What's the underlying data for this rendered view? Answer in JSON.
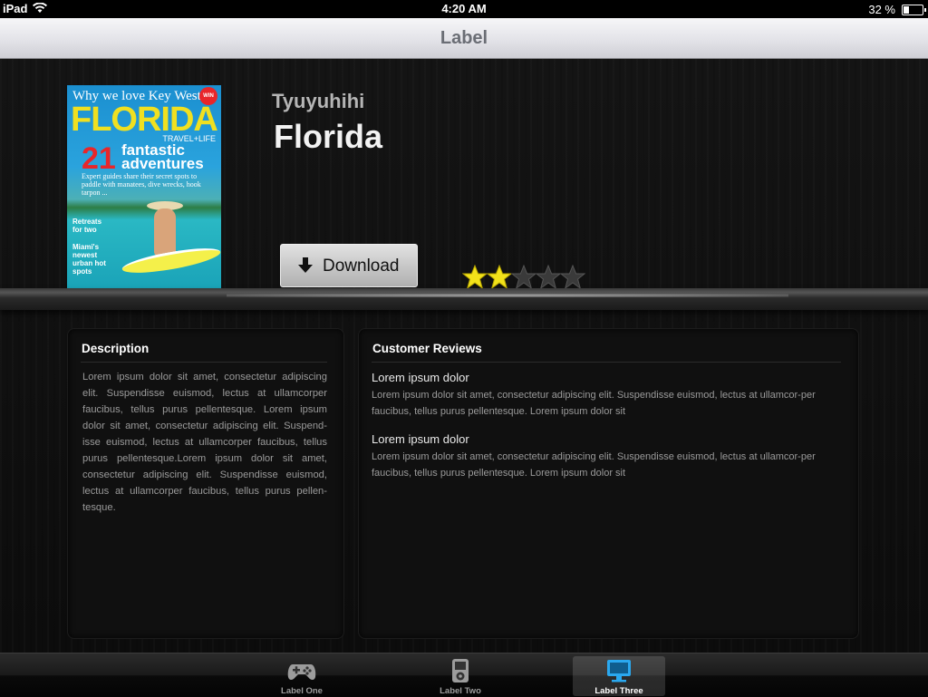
{
  "status_bar": {
    "device": "iPad",
    "time": "4:20 AM",
    "battery": "32 %",
    "battery_level_percent": 32
  },
  "nav": {
    "title": "Label"
  },
  "magazine": {
    "cover": {
      "tagline": "Why we love Key West",
      "masthead": "FLORIDA",
      "brand": "TRAVEL+LIFE",
      "badge": "WIN",
      "headline_number": "21",
      "headline_text": "fantastic adventures",
      "blurb": "Expert guides share their secret spots to paddle with manatees, dive wrecks, hook tarpon ...",
      "side1": "Retreats for two",
      "side2": "Miami's newest urban hot spots"
    },
    "subtitle": "Tyuyuhihi",
    "title": "Florida",
    "download_label": "Download",
    "rating": {
      "value": 2,
      "max": 5,
      "filled_color": "#f2e21a",
      "empty_color": "#3a3a3a"
    }
  },
  "description": {
    "heading": "Description",
    "text": "Lorem ipsum dolor sit amet, consectetur adipiscing elit. Suspendisse euismod, lectus at ullamcorper faucibus, tellus purus pellentesque. Lorem ipsum dolor sit amet, consectetur adipiscing elit. Suspend-isse euismod, lectus at ullamcorper faucibus, tellus purus pellentesque.Lorem ipsum dolor sit amet, consectetur adipiscing elit. Suspendisse euismod, lectus at ullamcorper faucibus, tellus purus pellen-tesque."
  },
  "reviews": {
    "heading": "Customer Reviews",
    "items": [
      {
        "title": "Lorem ipsum dolor",
        "body": "Lorem ipsum dolor sit amet, consectetur adipiscing elit. Suspendisse euismod, lectus at ullamcor-per faucibus, tellus purus pellentesque. Lorem ipsum dolor sit"
      },
      {
        "title": "Lorem ipsum dolor",
        "body": "Lorem ipsum dolor sit amet, consectetur adipiscing elit. Suspendisse euismod, lectus at ullamcor-per faucibus, tellus purus pellentesque. Lorem ipsum dolor sit"
      }
    ]
  },
  "tabs": [
    {
      "label": "Label One",
      "icon": "gamepad-icon",
      "selected": false
    },
    {
      "label": "Label Two",
      "icon": "ipod-icon",
      "selected": false
    },
    {
      "label": "Label Three",
      "icon": "monitor-icon",
      "selected": true
    }
  ],
  "colors": {
    "accent_tab_icon": "#2aa8ef",
    "background": "#0c0c0c"
  }
}
